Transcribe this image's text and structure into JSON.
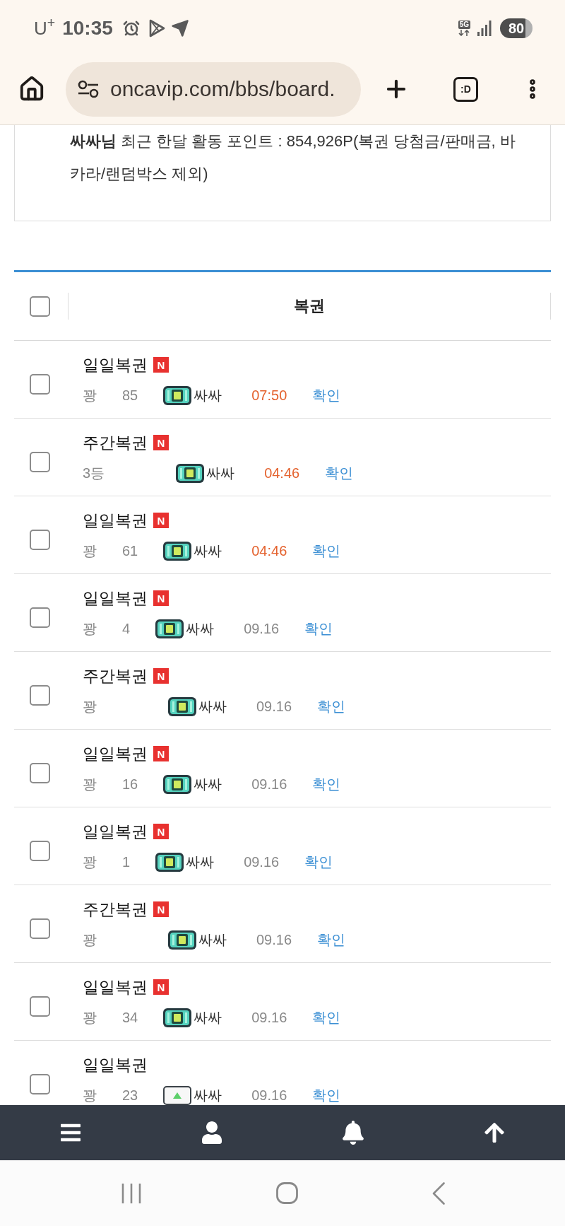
{
  "status_bar": {
    "carrier": "U$^{+}$",
    "time": "10:35",
    "network": "5G",
    "battery": "80"
  },
  "browser_bar": {
    "url": "oncavip.com/bbs/board.",
    "tab_switcher": ":D"
  },
  "notice": {
    "text": "**싸싸님** 최근 한달 활동 포인트 : 854,926P(복권 당첨금/판매금, 바카라/랜덤박스 제외)"
  },
  "board": {
    "header": {
      "title": "복권",
      "checked": false
    },
    "rows": [
      {
        "title": "일일복권",
        "new_badge": "N",
        "result": "꽝",
        "count": "85",
        "author": "싸싸",
        "badge_loaded": true,
        "date": "07:50",
        "recent": true,
        "action": "확인",
        "checked": false
      },
      {
        "title": "주간복권",
        "new_badge": "N",
        "result": "3등",
        "author": "싸싸",
        "badge_loaded": true,
        "date": "04:46",
        "recent": true,
        "action": "확인",
        "checked": false
      },
      {
        "title": "일일복권",
        "new_badge": "N",
        "result": "꽝",
        "count": "61",
        "author": "싸싸",
        "badge_loaded": true,
        "date": "04:46",
        "recent": true,
        "action": "확인",
        "checked": false
      },
      {
        "title": "일일복권",
        "new_badge": "N",
        "result": "꽝",
        "count": "4",
        "author": "싸싸",
        "badge_loaded": true,
        "date": "09.16",
        "recent": false,
        "action": "확인",
        "checked": false
      },
      {
        "title": "주간복권",
        "new_badge": "N",
        "result": "꽝",
        "author": "싸싸",
        "badge_loaded": true,
        "date": "09.16",
        "recent": false,
        "action": "확인",
        "checked": false
      },
      {
        "title": "일일복권",
        "new_badge": "N",
        "result": "꽝",
        "count": "16",
        "author": "싸싸",
        "badge_loaded": true,
        "date": "09.16",
        "recent": false,
        "action": "확인",
        "checked": false
      },
      {
        "title": "일일복권",
        "new_badge": "N",
        "result": "꽝",
        "count": "1",
        "author": "싸싸",
        "badge_loaded": true,
        "date": "09.16",
        "recent": false,
        "action": "확인",
        "checked": false
      },
      {
        "title": "주간복권",
        "new_badge": "N",
        "result": "꽝",
        "author": "싸싸",
        "badge_loaded": true,
        "date": "09.16",
        "recent": false,
        "action": "확인",
        "checked": false
      },
      {
        "title": "일일복권",
        "new_badge": "N",
        "result": "꽝",
        "count": "34",
        "author": "싸싸",
        "badge_loaded": true,
        "date": "09.16",
        "recent": false,
        "action": "확인",
        "checked": false
      },
      {
        "title": "일일복권",
        "result": "꽝",
        "count": "23",
        "author": "싸싸",
        "badge_loaded": false,
        "date": "09.16",
        "recent": false,
        "action": "확인",
        "checked": false
      }
    ]
  }
}
